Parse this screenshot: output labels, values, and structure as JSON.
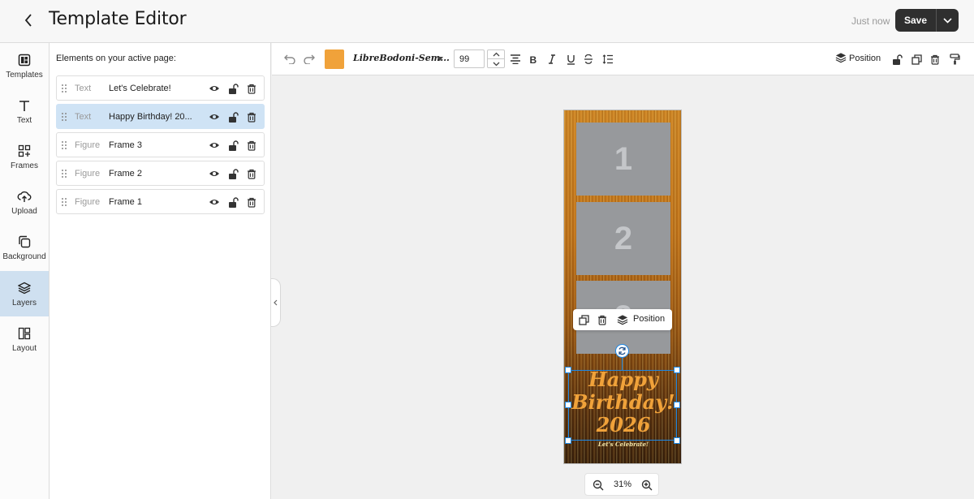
{
  "header": {
    "title": "Template Editor",
    "save_status": "Just now",
    "save_label": "Save"
  },
  "nav": {
    "items": [
      {
        "label": "Templates",
        "icon": "templates-icon"
      },
      {
        "label": "Text",
        "icon": "text-icon"
      },
      {
        "label": "Frames",
        "icon": "frames-icon"
      },
      {
        "label": "Upload",
        "icon": "upload-icon"
      },
      {
        "label": "Background",
        "icon": "background-icon"
      },
      {
        "label": "Layers",
        "icon": "layers-icon",
        "active": true
      },
      {
        "label": "Layout",
        "icon": "layout-icon"
      }
    ]
  },
  "layers_panel": {
    "title": "Elements on your active page:",
    "rows": [
      {
        "type": "Text",
        "name": "Let's Celebrate!"
      },
      {
        "type": "Text",
        "name": "Happy Birthday! 20...",
        "selected": true
      },
      {
        "type": "Figure",
        "name": "Frame 3"
      },
      {
        "type": "Figure",
        "name": "Frame 2"
      },
      {
        "type": "Figure",
        "name": "Frame 1"
      }
    ]
  },
  "toolbar": {
    "text_color": "#f0a23a",
    "font_name": "LibreBodoni-Sem...",
    "font_size": "99",
    "position_label": "Position"
  },
  "canvas": {
    "frames": [
      "1",
      "2",
      "3"
    ],
    "birthday_lines": [
      "Happy",
      "Birthday!",
      "2026"
    ],
    "celebrate_text": "Let's Celebrate!",
    "float_toolbar_position": "Position",
    "zoom": "31%"
  },
  "colors": {
    "selection": "#1e88e5",
    "active_nav": "#cfe0f0",
    "selected_row": "#cfe3f5",
    "save_button": "#2f2f2f"
  }
}
